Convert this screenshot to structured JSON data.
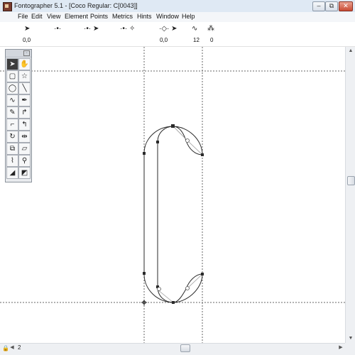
{
  "window": {
    "title": "Fontographer 5.1 - [Coco Regular: C[0043]]"
  },
  "window_controls": {
    "minimize": "–",
    "restore": "⧉",
    "close": "✕"
  },
  "menu": [
    "File",
    "Edit",
    "View",
    "Element",
    "Points",
    "Metrics",
    "Hints",
    "Window",
    "Help"
  ],
  "toolbar": {
    "pointer_coords": "0,0",
    "selection_coords": "0,0",
    "curve_value": "12",
    "outline_value": "0"
  },
  "palette": {
    "tools": [
      {
        "name": "pointer-tool",
        "glyph": "➤",
        "active": true
      },
      {
        "name": "hand-tool",
        "glyph": "✋",
        "active": false
      },
      {
        "name": "rectangle-tool",
        "glyph": "▢",
        "active": false
      },
      {
        "name": "star-tool",
        "glyph": "☆",
        "active": false
      },
      {
        "name": "ellipse-tool",
        "glyph": "◯",
        "active": false
      },
      {
        "name": "line-tool",
        "glyph": "╲",
        "active": false
      },
      {
        "name": "freehand-tool",
        "glyph": "∿",
        "active": false
      },
      {
        "name": "calligraphy-pen-tool",
        "glyph": "✒",
        "active": false
      },
      {
        "name": "pen-tool",
        "glyph": "✎",
        "active": false
      },
      {
        "name": "curve-point-tool",
        "glyph": "↱",
        "active": false
      },
      {
        "name": "corner-point-tool",
        "glyph": "⌐",
        "active": false
      },
      {
        "name": "tangent-point-tool",
        "glyph": "↰",
        "active": false
      },
      {
        "name": "rotate-tool",
        "glyph": "↻",
        "active": false
      },
      {
        "name": "reflect-tool",
        "glyph": "⇹",
        "active": false
      },
      {
        "name": "scale-tool",
        "glyph": "⧉",
        "active": false
      },
      {
        "name": "skew-tool",
        "glyph": "▱",
        "active": false
      },
      {
        "name": "knife-tool",
        "glyph": "⌇",
        "active": false
      },
      {
        "name": "zoom-tool",
        "glyph": "⚲",
        "active": false
      },
      {
        "name": "measure-tool",
        "glyph": "◢",
        "active": false
      },
      {
        "name": "perspective-tool",
        "glyph": "◩",
        "active": false
      }
    ]
  },
  "scrollbar": {
    "page_number": "2"
  }
}
